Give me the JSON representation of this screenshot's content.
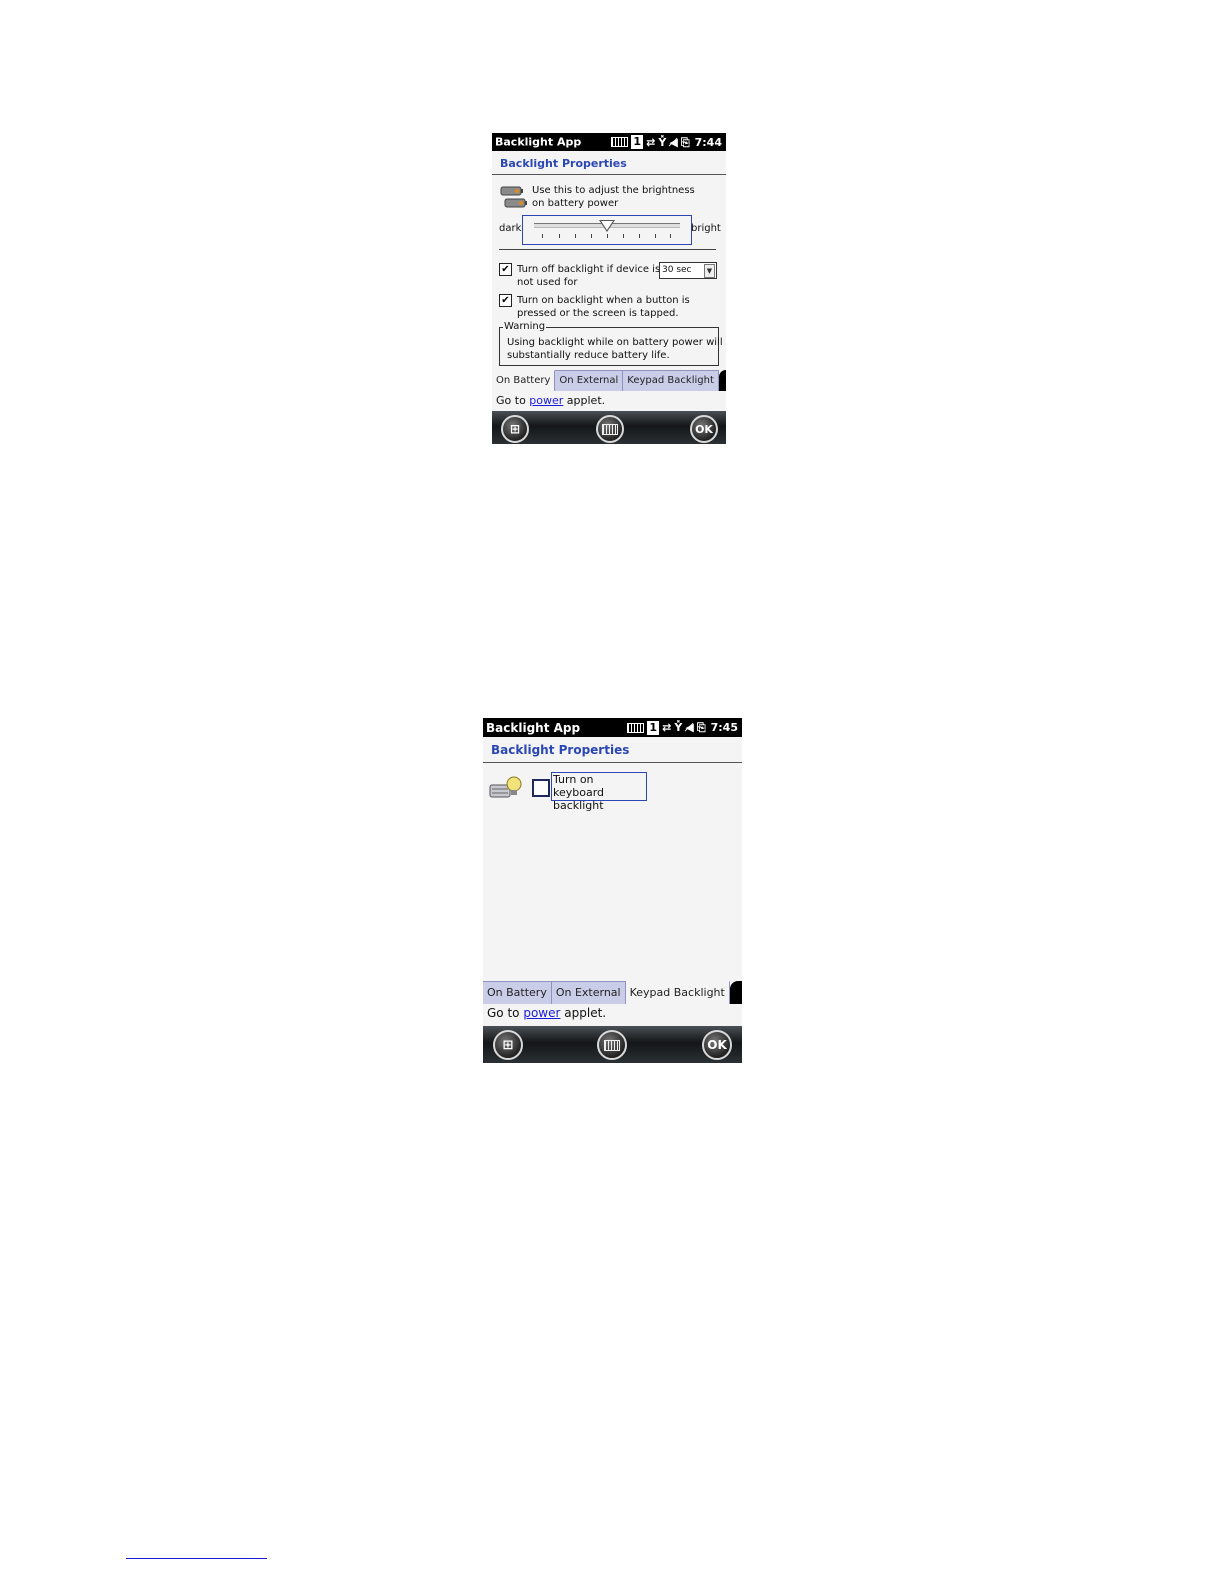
{
  "screen1": {
    "status": {
      "title": "Backlight App",
      "slot": "1",
      "time": "7:44"
    },
    "header": "Backlight Properties",
    "desc_line1": "Use this to adjust the brightness",
    "desc_line2": "on battery power",
    "dark_label": "dark",
    "bright_label": "bright",
    "opt1_line1": "Turn off backlight if device is",
    "opt1_line2": "not used for",
    "opt1_checked": "✔",
    "timeout_value": "30 sec",
    "opt2_line1": "Turn on backlight when a button is",
    "opt2_line2": "pressed or the screen is tapped.",
    "opt2_checked": "✔",
    "warning_label": "Warning",
    "warning_line1": "Using backlight while on battery power will",
    "warning_line2": "substantially reduce battery life.",
    "tabs": [
      "On Battery",
      "On External",
      "Keypad Backlight"
    ],
    "goto_pre": "Go to",
    "goto_link": "power",
    "goto_post": "applet.",
    "ok": "OK"
  },
  "screen2": {
    "status": {
      "title": "Backlight App",
      "slot": "1",
      "time": "7:45"
    },
    "header": "Backlight Properties",
    "kb_line1": "Turn on keyboard",
    "kb_line2": "backlight",
    "tabs": [
      "On Battery",
      "On External",
      "Keypad Backlight"
    ],
    "goto_pre": "Go to",
    "goto_link": "power",
    "goto_post": "applet.",
    "ok": "OK"
  }
}
